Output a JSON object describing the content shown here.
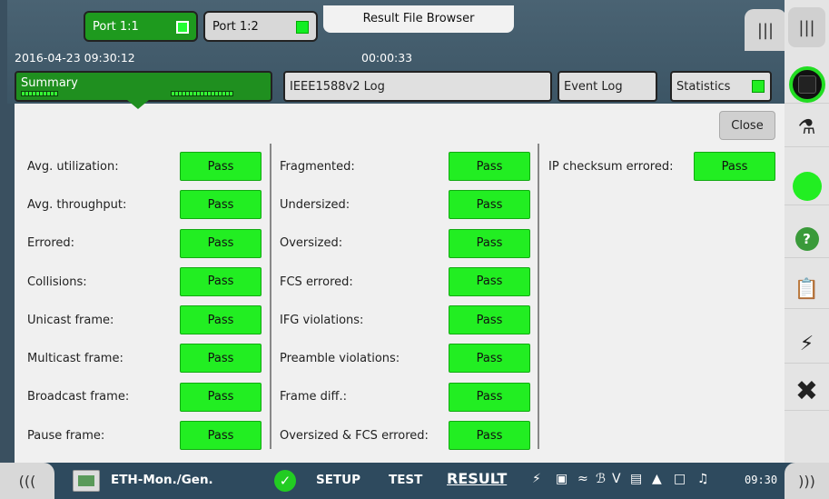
{
  "header": {
    "port1_label": "Port 1:1",
    "port2_label": "Port 1:2",
    "result_file_browser": "Result File Browser",
    "datetime": "2016-04-23 09:30:12",
    "elapsed": "00:00:33",
    "menu_icon": "|||"
  },
  "tabs": {
    "summary": "Summary",
    "log": "IEEE1588v2 Log",
    "event_log": "Event Log",
    "statistics": "Statistics"
  },
  "panel": {
    "close_label": "Close",
    "col1": [
      {
        "label": "Avg. utilization:",
        "status": "Pass"
      },
      {
        "label": "Avg. throughput:",
        "status": "Pass"
      },
      {
        "label": "Errored:",
        "status": "Pass"
      },
      {
        "label": "Collisions:",
        "status": "Pass"
      },
      {
        "label": "Unicast frame:",
        "status": "Pass"
      },
      {
        "label": "Multicast frame:",
        "status": "Pass"
      },
      {
        "label": "Broadcast frame:",
        "status": "Pass"
      },
      {
        "label": "Pause frame:",
        "status": "Pass"
      }
    ],
    "col2": [
      {
        "label": "Fragmented:",
        "status": "Pass"
      },
      {
        "label": "Undersized:",
        "status": "Pass"
      },
      {
        "label": "Oversized:",
        "status": "Pass"
      },
      {
        "label": "FCS errored:",
        "status": "Pass"
      },
      {
        "label": "IFG violations:",
        "status": "Pass"
      },
      {
        "label": "Preamble violations:",
        "status": "Pass"
      },
      {
        "label": "Frame diff.:",
        "status": "Pass"
      },
      {
        "label": "Oversized & FCS errored:",
        "status": "Pass"
      }
    ],
    "col3": [
      {
        "label": "IP checksum errored:",
        "status": "Pass"
      }
    ]
  },
  "bottom": {
    "left_arrow": "(((",
    "app_name": "ETH-Mon./Gen.",
    "setup": "SETUP",
    "test": "TEST",
    "result": "RESULT",
    "clock": "09:30",
    "right_arrow": ")))"
  },
  "colors": {
    "pass": "#22ee22",
    "active_tab": "#1f8f1f",
    "header_bg": "#3c5565"
  }
}
